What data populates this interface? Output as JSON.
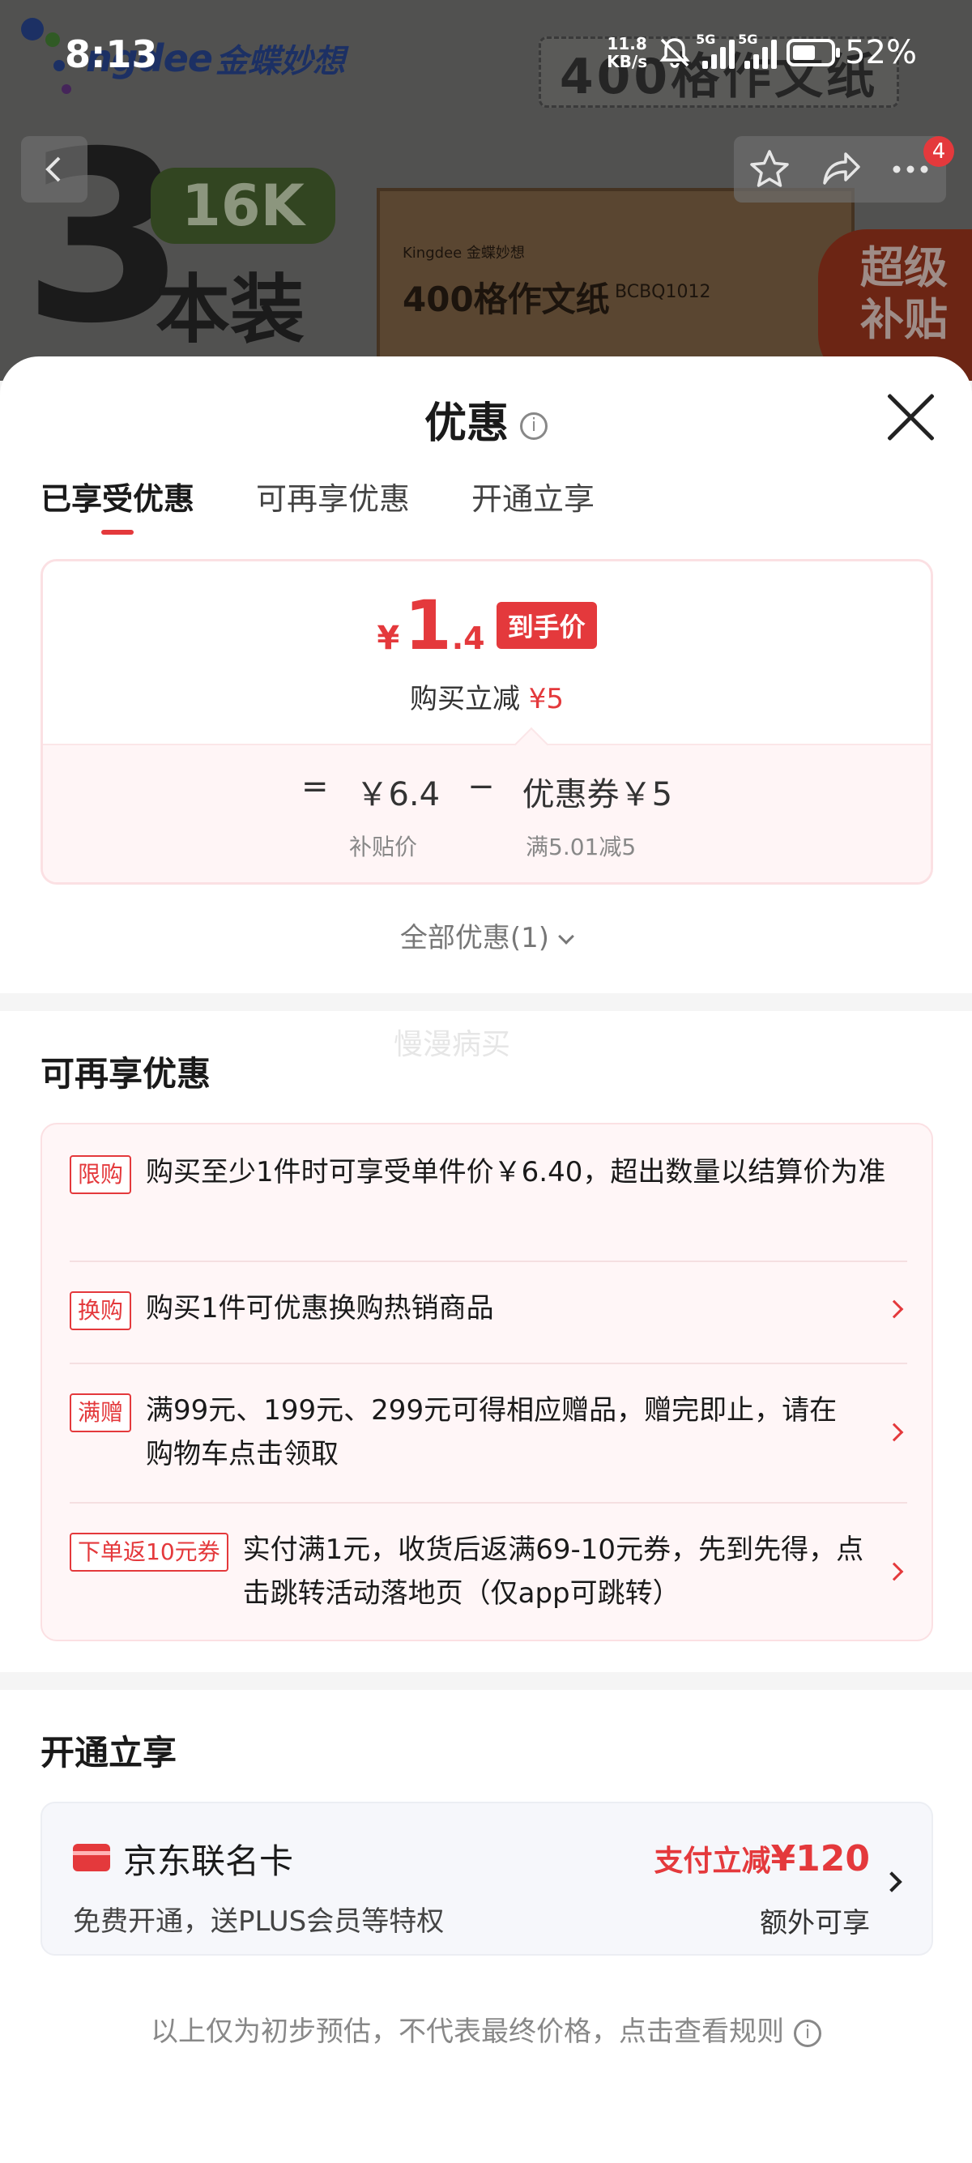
{
  "status_bar": {
    "time": "8:13",
    "net_speed_value": "11.8",
    "net_speed_unit": "KB/s",
    "signal1_label": "5G",
    "signal2_label": "5G",
    "battery_percent": "52%",
    "battery_level": 0.52
  },
  "hero": {
    "brand_latin": "ngdee",
    "brand_cn": "金蝶妙想",
    "top_banner": "400格作文纸",
    "big_number": "3",
    "size_badge": "16K",
    "pack_text": "本装",
    "box_brand": "Kingdee 金蝶妙想",
    "box_title": "400格作文纸",
    "box_code": "BCBQ1012",
    "promo_badge_line1": "超级",
    "promo_badge_line2": "补贴",
    "cart_count": "4"
  },
  "sheet": {
    "title": "优惠",
    "info_glyph": "i",
    "tabs": [
      {
        "label": "已享受优惠"
      },
      {
        "label": "可再享优惠"
      },
      {
        "label": "开通立享"
      }
    ],
    "price": {
      "currency": "¥",
      "integer": "1",
      "decimal": ".4",
      "tag": "到手价",
      "reduce_label": "购买立减",
      "reduce_amount": "¥5"
    },
    "formula": {
      "equals": "=",
      "base_price": "￥6.4",
      "minus": "−",
      "coupon": "优惠券￥5",
      "base_label": "补贴价",
      "coupon_label": "满5.01减5"
    },
    "all_offers": "全部优惠(1)",
    "watermark": "慢漫病买",
    "section2_title": "可再享优惠",
    "offers": [
      {
        "tag": "限购",
        "text": "购买至少1件时可享受单件价￥6.40，超出数量以结算价为准"
      },
      {
        "tag": "换购",
        "text": "购买1件可优惠换购热销商品"
      },
      {
        "tag": "满赠",
        "text": "满99元、199元、299元可得相应赠品，赠完即止，请在购物车点击领取"
      },
      {
        "tag": "下单返10元券",
        "text": "实付满1元，收货后返满69-10元券，先到先得，点击跳转活动落地页（仅app可跳转）"
      }
    ],
    "section3_title": "开通立享",
    "card": {
      "name": "京东联名卡",
      "desc": "免费开通，送PLUS会员等特权",
      "promo_prefix": "支付立减",
      "promo_amount": "¥120",
      "extra": "额外可享"
    },
    "footnote": "以上仅为初步预估，不代表最终价格，点击查看规则"
  },
  "colors": {
    "accent": "#e4393c",
    "tab_indicator": "#e4393c",
    "price_red": "#e4393c",
    "card_bg": "#f6f7fb",
    "offers_bg": "#fff6f7"
  }
}
